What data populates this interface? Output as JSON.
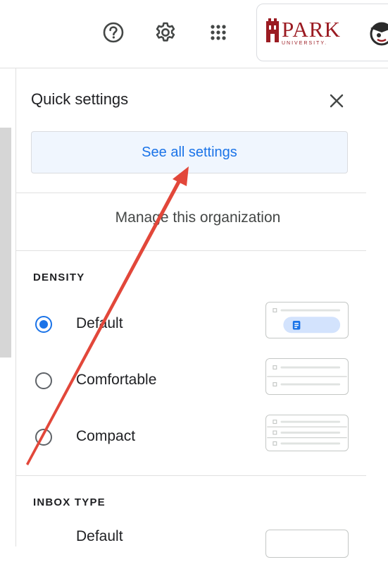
{
  "header": {
    "help_icon": "help-icon",
    "settings_icon": "gear-icon",
    "apps_icon": "apps-grid-icon",
    "org_logo": {
      "word": "PARK",
      "subtitle": "UNIVERSITY."
    },
    "brand_color": "#9b1b22"
  },
  "quick_settings": {
    "title": "Quick settings",
    "see_all_label": "See all settings",
    "manage_label": "Manage this organization",
    "density": {
      "heading": "DENSITY",
      "options": [
        {
          "label": "Default",
          "selected": true
        },
        {
          "label": "Comfortable",
          "selected": false
        },
        {
          "label": "Compact",
          "selected": false
        }
      ]
    },
    "inbox_type": {
      "heading": "INBOX TYPE",
      "first_option_label": "Default"
    }
  },
  "colors": {
    "accent": "#1a73e8",
    "annotation_arrow": "#e2473a"
  }
}
